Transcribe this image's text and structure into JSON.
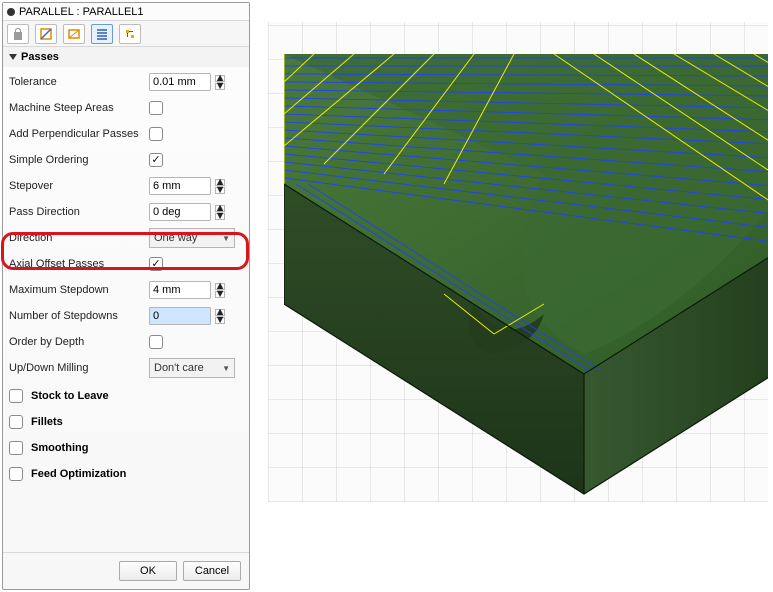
{
  "title": "PARALLEL : PARALLEL1",
  "section": "Passes",
  "rows": {
    "tolerance": {
      "label": "Tolerance",
      "value": "0.01 mm"
    },
    "steep": {
      "label": "Machine Steep Areas",
      "checked": false
    },
    "perp": {
      "label": "Add Perpendicular Passes",
      "checked": false
    },
    "simple": {
      "label": "Simple Ordering",
      "checked": true
    },
    "stepover": {
      "label": "Stepover",
      "value": "6 mm"
    },
    "passdir": {
      "label": "Pass Direction",
      "value": "0 deg"
    },
    "direction": {
      "label": "Direction",
      "value": "One way"
    },
    "axial": {
      "label": "Axial Offset Passes",
      "checked": true
    },
    "maxstep": {
      "label": "Maximum Stepdown",
      "value": "4 mm"
    },
    "numstep": {
      "label": "Number of Stepdowns",
      "value": "0"
    },
    "orderdepth": {
      "label": "Order by Depth",
      "checked": false
    },
    "updown": {
      "label": "Up/Down Milling",
      "value": "Don't care"
    }
  },
  "subsections": {
    "stock": "Stock to Leave",
    "fillets": "Fillets",
    "smooth": "Smoothing",
    "feed": "Feed Optimization"
  },
  "buttons": {
    "ok": "OK",
    "cancel": "Cancel"
  }
}
